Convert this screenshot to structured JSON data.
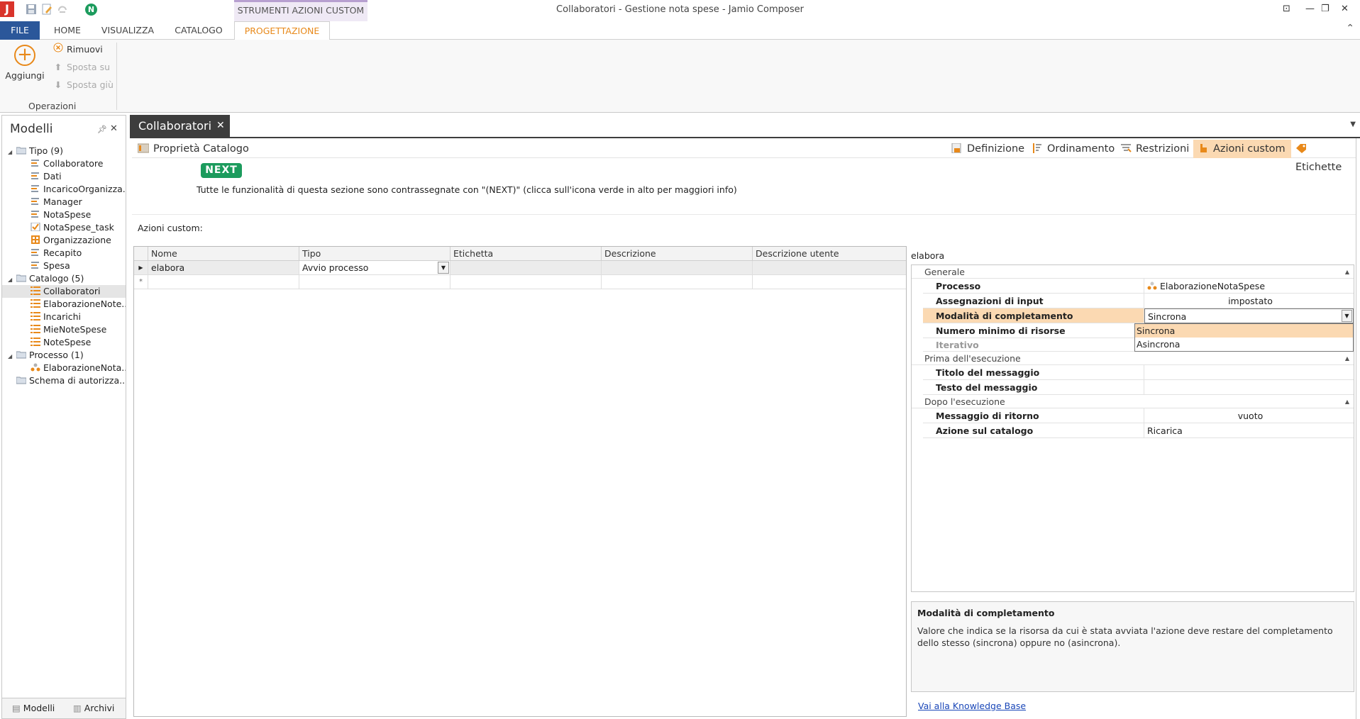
{
  "window": {
    "title": "Collaboratori - Gestione nota spese - Jamio Composer",
    "context_tab_title": "STRUMENTI AZIONI CUSTOM",
    "quick_new_badge": "N"
  },
  "ribbon": {
    "tabs": [
      "FILE",
      "HOME",
      "VISUALIZZA",
      "CATALOGO",
      "PROGETTAZIONE"
    ],
    "active_tab": "PROGETTAZIONE",
    "add_label": "Aggiungi",
    "remove_label": "Rimuovi",
    "move_up_label": "Sposta su",
    "move_down_label": "Sposta giù",
    "group_label": "Operazioni"
  },
  "left_panel": {
    "title": "Modelli",
    "tree": [
      {
        "label": "Tipo (9)",
        "level": 0,
        "icon": "folder-icon"
      },
      {
        "label": "Collaboratore",
        "level": 1,
        "icon": "type-icon"
      },
      {
        "label": "Dati",
        "level": 1,
        "icon": "type-icon"
      },
      {
        "label": "IncaricoOrganizza...",
        "level": 1,
        "icon": "type-icon"
      },
      {
        "label": "Manager",
        "level": 1,
        "icon": "type-icon"
      },
      {
        "label": "NotaSpese",
        "level": 1,
        "icon": "type-icon"
      },
      {
        "label": "NotaSpese_task",
        "level": 1,
        "icon": "task-icon"
      },
      {
        "label": "Organizzazione",
        "level": 1,
        "icon": "org-icon"
      },
      {
        "label": "Recapito",
        "level": 1,
        "icon": "type-icon"
      },
      {
        "label": "Spesa",
        "level": 1,
        "icon": "type-icon"
      },
      {
        "label": "Catalogo (5)",
        "level": 0,
        "icon": "folder-icon"
      },
      {
        "label": "Collaboratori",
        "level": 1,
        "icon": "catalog-icon",
        "selected": true
      },
      {
        "label": "ElaborazioneNote...",
        "level": 1,
        "icon": "catalog-icon"
      },
      {
        "label": "Incarichi",
        "level": 1,
        "icon": "catalog-icon"
      },
      {
        "label": "MieNoteSpese",
        "level": 1,
        "icon": "catalog-icon"
      },
      {
        "label": "NoteSpese",
        "level": 1,
        "icon": "catalog-icon"
      },
      {
        "label": "Processo (1)",
        "level": 0,
        "icon": "folder-icon"
      },
      {
        "label": "ElaborazioneNota...",
        "level": 1,
        "icon": "process-icon"
      },
      {
        "label": "Schema di autorizza...",
        "level": 0,
        "icon": "folder-icon",
        "leaf": true
      }
    ],
    "bottom_tabs": [
      "Modelli",
      "Archivi"
    ]
  },
  "document": {
    "tab_label": "Collaboratori",
    "properties_label": "Proprietà Catalogo",
    "views": [
      "Definizione",
      "Ordinamento",
      "Restrizioni",
      "Azioni custom",
      "Etichette"
    ],
    "active_view": "Azioni custom",
    "next_badge": "NEXT",
    "next_info": "Tutte le funzionalità di questa sezione sono contrassegnate con \"(NEXT)\" (clicca sull'icona verde in alto per maggiori info)",
    "azioni_label": "Azioni custom:"
  },
  "grid": {
    "columns": [
      "Nome",
      "Tipo",
      "Etichetta",
      "Descrizione",
      "Descrizione utente"
    ],
    "rows": [
      {
        "nome": "elabora",
        "tipo": "Avvio processo",
        "etichetta": "",
        "descrizione": "",
        "descrizione_utente": ""
      }
    ],
    "new_row_marker": "*"
  },
  "properties": {
    "object_name": "elabora",
    "categories": {
      "generale": "Generale",
      "prima": "Prima dell'esecuzione",
      "dopo": "Dopo l'esecuzione"
    },
    "rows": {
      "processo": {
        "name": "Processo",
        "value": "ElaborazioneNotaSpese"
      },
      "assegnazioni": {
        "name": "Assegnazioni di input",
        "value": "impostato"
      },
      "modalita": {
        "name": "Modalità di completamento",
        "value": "Sincrona"
      },
      "numero": {
        "name": "Numero minimo di risorse",
        "value": ""
      },
      "iterativo": {
        "name": "Iterativo",
        "value": ""
      },
      "titolo": {
        "name": "Titolo del messaggio",
        "value": ""
      },
      "testo": {
        "name": "Testo del messaggio",
        "value": ""
      },
      "messaggio": {
        "name": "Messaggio di ritorno",
        "value": "vuoto"
      },
      "azione": {
        "name": "Azione sul catalogo",
        "value": "Ricarica"
      }
    },
    "dropdown_options": [
      "Sincrona",
      "Asincrona"
    ],
    "dropdown_selected": "Sincrona"
  },
  "description": {
    "title": "Modalità di completamento",
    "text": "Valore che indica se la risorsa da cui è stata avviata l'azione deve restare del completamento dello stesso (sincrona) oppure no (asincrona).",
    "kb_link": "Vai alla Knowledge Base"
  },
  "colors": {
    "accent_orange": "#e8891a",
    "selection_orange": "#fbd9b2",
    "file_tab_blue": "#2b579a",
    "next_green": "#1c9b5d",
    "doc_tab_dark": "#3d3d3d"
  }
}
